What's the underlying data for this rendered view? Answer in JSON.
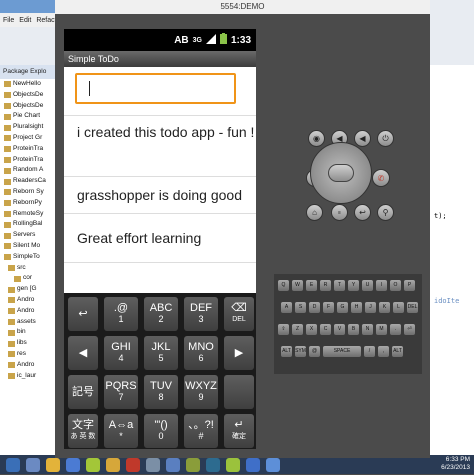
{
  "eclipse": {
    "menu": [
      "File",
      "Edit",
      "Refacto"
    ],
    "explorer_tab": "Package Explo",
    "tree_items": [
      "NewHello",
      "ObjectsDe",
      "ObjectsDe",
      "Pie Chart",
      "Pluralsight",
      "Project Gr",
      "ProteinTra",
      "ProteinTra",
      "Random A",
      "ReadersCa",
      "Reborn Sy",
      "RebornPy",
      "RemoteSy",
      "RollingBal",
      "Servers",
      "Silent Mo",
      "SimpleTo",
      "src",
      "cor",
      "gen [G",
      "Andro",
      "Andro",
      "assets",
      "bin",
      "libs",
      "res",
      "Andro",
      "ic_laur"
    ],
    "code_fragments": [
      "t);",
      "idoIte"
    ]
  },
  "emulator": {
    "title": "5554:DEMO"
  },
  "phone": {
    "status_time": "1:33",
    "status_icons": [
      "AB",
      "3G",
      "signal",
      "battery"
    ],
    "app_title": "Simple ToDo",
    "input_value": "",
    "todos": [
      "i created this todo app - fun !",
      "grasshopper is doing good",
      "Great effort learning"
    ]
  },
  "keyboard": {
    "rows": [
      [
        {
          "main": "↩",
          "sub": ""
        },
        {
          "main": ".@",
          "sub": "1"
        },
        {
          "main": "ABC",
          "sub": "2"
        },
        {
          "main": "DEF",
          "sub": "3"
        },
        {
          "main": "⌫",
          "sub": "DEL"
        }
      ],
      [
        {
          "main": "◀",
          "sub": ""
        },
        {
          "main": "GHI",
          "sub": "4"
        },
        {
          "main": "JKL",
          "sub": "5"
        },
        {
          "main": "MNO",
          "sub": "6"
        },
        {
          "main": "▶",
          "sub": ""
        }
      ],
      [
        {
          "main": "記号",
          "sub": ""
        },
        {
          "main": "PQRS",
          "sub": "7"
        },
        {
          "main": "TUV",
          "sub": "8"
        },
        {
          "main": "WXYZ",
          "sub": "9"
        },
        {
          "main": "",
          "sub": ""
        }
      ],
      [
        {
          "main": "文字",
          "sub": "あ 英 数"
        },
        {
          "main": "A⇔a",
          "sub": "*"
        },
        {
          "main": "'\"()",
          "sub": "0"
        },
        {
          "main": "、。?!",
          "sub": "#"
        },
        {
          "main": "↵",
          "sub": "確定"
        }
      ]
    ]
  },
  "hardware_keys": {
    "row1": [
      "Q",
      "W",
      "E",
      "R",
      "T",
      "Y",
      "U",
      "I",
      "O",
      "P"
    ],
    "row2": [
      "A",
      "S",
      "D",
      "F",
      "G",
      "H",
      "J",
      "K",
      "L",
      "DEL"
    ],
    "row3": [
      "⇧",
      "Z",
      "X",
      "C",
      "V",
      "B",
      "N",
      "M",
      ".",
      "⏎"
    ],
    "row4": [
      "ALT",
      "SYM",
      "@",
      "SPACE",
      "/",
      ",",
      "ALT"
    ]
  },
  "taskbar": {
    "time": "6:33 PM",
    "date": "6/23/2013"
  },
  "colors": {
    "input_focus": "#f09418",
    "status_bar": "#000000",
    "keyboard_bg": "#1b1b1b"
  }
}
